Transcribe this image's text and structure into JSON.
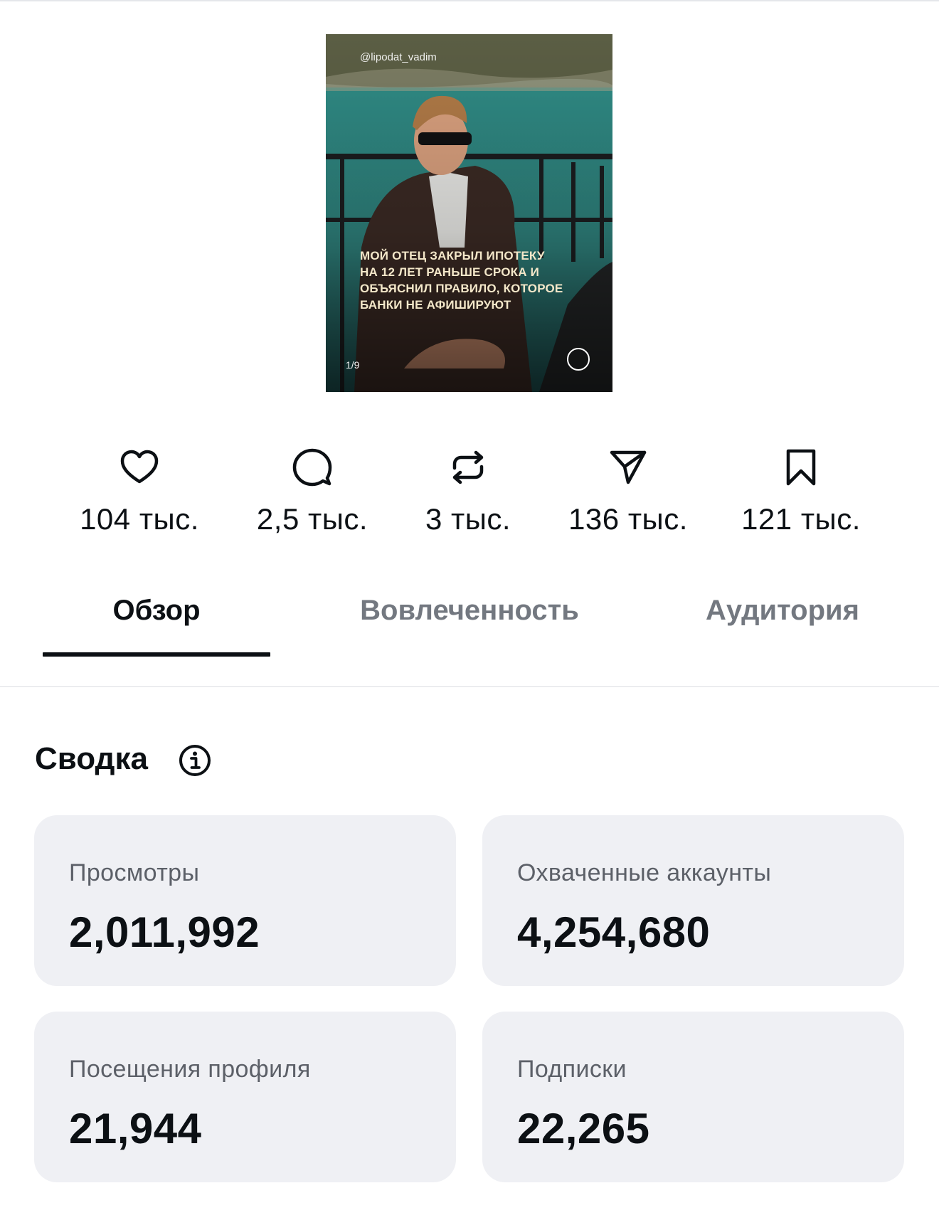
{
  "post": {
    "handle": "@lipodat_vadim",
    "overlay_text": "МОЙ ОТЕЦ ЗАКРЫЛ ИПОТЕКУ\nНА 12 ЛЕТ РАНЬШЕ СРОКА И\nОБЪЯСНИЛ ПРАВИЛО, КОТОРОЕ\nБАНКИ НЕ АФИШИРУЮТ",
    "counter": "1/9",
    "next_icon": "chevron-right-circle-icon"
  },
  "stats": [
    {
      "icon": "heart-icon",
      "value": "104 тыс."
    },
    {
      "icon": "comment-icon",
      "value": "2,5 тыс."
    },
    {
      "icon": "repost-icon",
      "value": "3 тыс."
    },
    {
      "icon": "share-icon",
      "value": "136 тыс."
    },
    {
      "icon": "bookmark-icon",
      "value": "121 тыс."
    }
  ],
  "tabs": [
    {
      "label": "Обзор",
      "active": true
    },
    {
      "label": "Вовлеченность",
      "active": false
    },
    {
      "label": "Аудитория",
      "active": false
    }
  ],
  "summary": {
    "title": "Сводка",
    "info_icon": "info-icon",
    "cards": [
      {
        "label": "Просмотры",
        "value": "2,011,992"
      },
      {
        "label": "Охваченные аккаунты",
        "value": "4,254,680"
      },
      {
        "label": "Посещения профиля",
        "value": "21,944"
      },
      {
        "label": "Подписки",
        "value": "22,265"
      }
    ]
  },
  "colors": {
    "text_primary": "#0c1014",
    "text_secondary": "#737880",
    "card_background": "#eff0f4",
    "overlay_text": "#f3e7c9"
  }
}
